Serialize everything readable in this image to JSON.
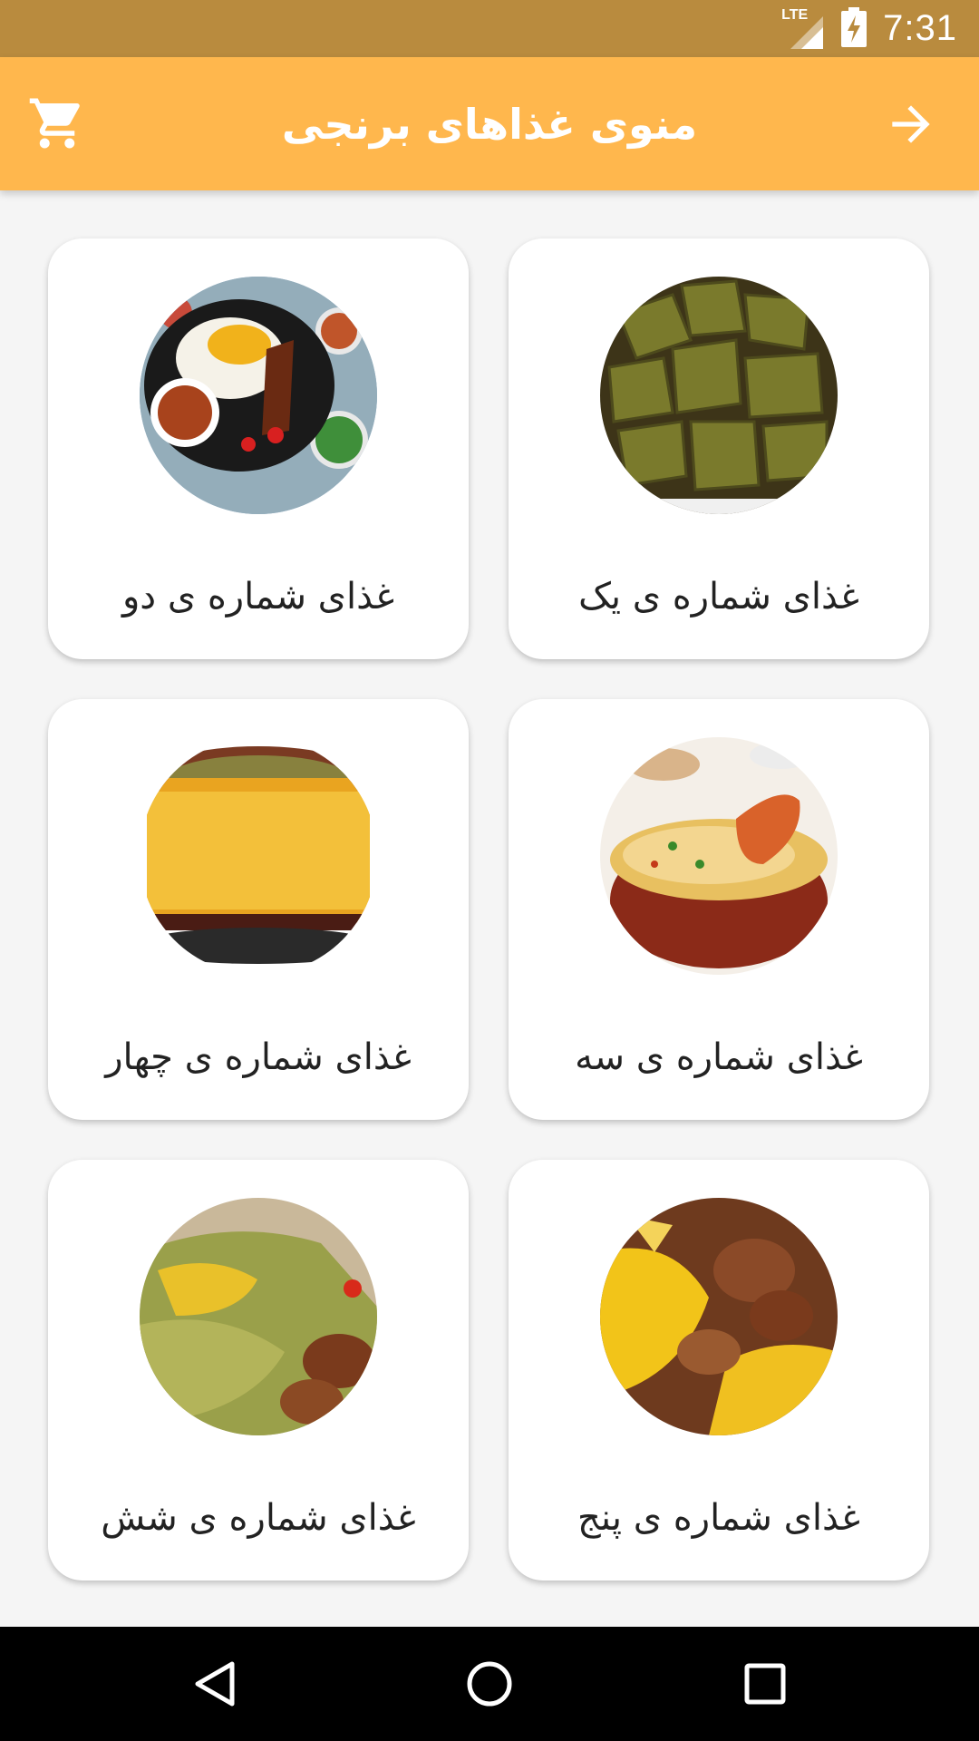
{
  "status_bar": {
    "time": "7:31",
    "network": "LTE",
    "background_color": "#b98b3e"
  },
  "app_bar": {
    "title": "منوی غذاهای برنجی",
    "background_color": "#ffb74d",
    "cart_icon": "shopping-cart-icon",
    "back_icon": "arrow-right-icon"
  },
  "menu": {
    "items": [
      {
        "label": "غذای شماره ی یک",
        "image": "stuffed-grape-leaves"
      },
      {
        "label": "غذای شماره ی دو",
        "image": "rice-platter-with-stew"
      },
      {
        "label": "غذای شماره ی سه",
        "image": "biryani-chicken-bowl"
      },
      {
        "label": "غذای شماره ی چهار",
        "image": "tahchin-rice-cake"
      },
      {
        "label": "غذای شماره ی پنج",
        "image": "saffron-rice-with-meat"
      },
      {
        "label": "غذای شماره ی شش",
        "image": "herb-rice-with-fish"
      }
    ]
  },
  "nav_bar": {
    "back_icon": "nav-back-icon",
    "home_icon": "nav-home-icon",
    "recents_icon": "nav-recents-icon"
  }
}
